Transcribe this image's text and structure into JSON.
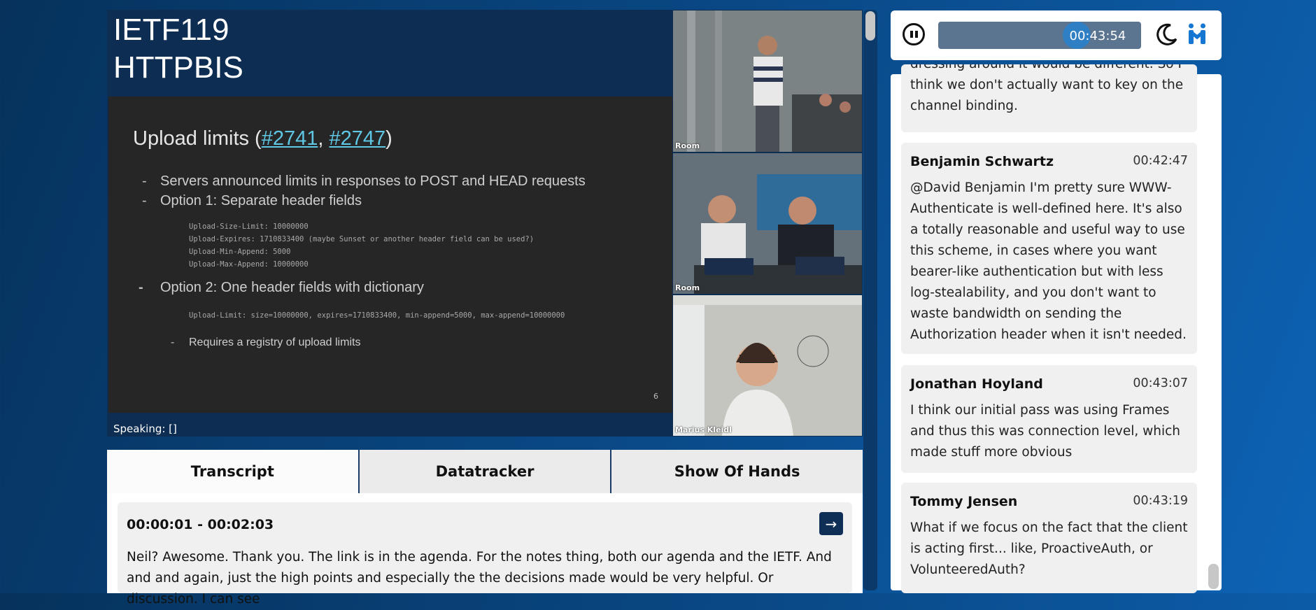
{
  "meeting": {
    "title_line1": "IETF119",
    "title_line2": "HTTPBIS",
    "speaking": "Speaking: []"
  },
  "slide": {
    "title_prefix": "Upload limits (",
    "link1": "#2741",
    "sep": ", ",
    "link2": "#2747",
    "title_suffix": ")",
    "bullets": [
      "Servers announced limits in responses to POST and HEAD requests",
      "Option 1: Separate header fields"
    ],
    "code_lines": [
      "Upload-Size-Limit: 10000000",
      "Upload-Expires: 1710833400 (maybe Sunset or another header field can be used?)",
      "Upload-Min-Append: 5000",
      "Upload-Max-Append: 10000000"
    ],
    "bullet3": "Option 2: One header fields with dictionary",
    "code_line2": "Upload-Limit: size=10000000, expires=1710833400, min-append=5000, max-append=10000000",
    "sub_bullet": "Requires a registry of upload limits",
    "page": "6",
    "dash": "-"
  },
  "video_tiles": [
    {
      "label": "Room"
    },
    {
      "label": "Room"
    },
    {
      "label": "Marius Kleidl"
    }
  ],
  "tabs": [
    {
      "label": "Transcript",
      "active": true
    },
    {
      "label": "Datatracker",
      "active": false
    },
    {
      "label": "Show Of Hands",
      "active": false
    }
  ],
  "transcript": {
    "time_range": "00:00:01 - 00:02:03",
    "go_icon": "arrow-right-icon",
    "text": "Neil? Awesome. Thank you. The link is in the agenda. For the notes thing, both our agenda and the IETF. And and and again, just the high points and especially the the decisions made would be very helpful. Or discussion. I can see"
  },
  "player": {
    "current_time": "00:43:54",
    "progress": 0.71,
    "pause_icon": "pause-icon",
    "theme_icon": "moon-icon",
    "logo": "meetecho-logo-icon"
  },
  "chat": [
    {
      "author": "",
      "time": "",
      "text": "dressing around it would be different. So I think we don't actually want to key on the channel binding."
    },
    {
      "author": "Benjamin Schwartz",
      "time": "00:42:47",
      "text": "@David Benjamin I'm pretty sure WWW-Authenticate is well-defined here. It's also a totally reasonable and useful way to use this scheme, in cases where you want bearer-like authentication but with less log-stealability, and you don't want to waste bandwidth on sending the Authorization header when it isn't needed."
    },
    {
      "author": "Jonathan Hoyland",
      "time": "00:43:07",
      "text": "I think our initial pass was using Frames and thus this was connection level, which made stuff more obvious"
    },
    {
      "author": "Tommy Jensen",
      "time": "00:43:19",
      "text": "What if we focus on the fact that the client is acting first... like, ProactiveAuth, or VolunteeredAuth?"
    }
  ],
  "colors": {
    "accent": "#0f2f57",
    "link": "#5fc7e4",
    "knob": "#2f7fc4"
  }
}
